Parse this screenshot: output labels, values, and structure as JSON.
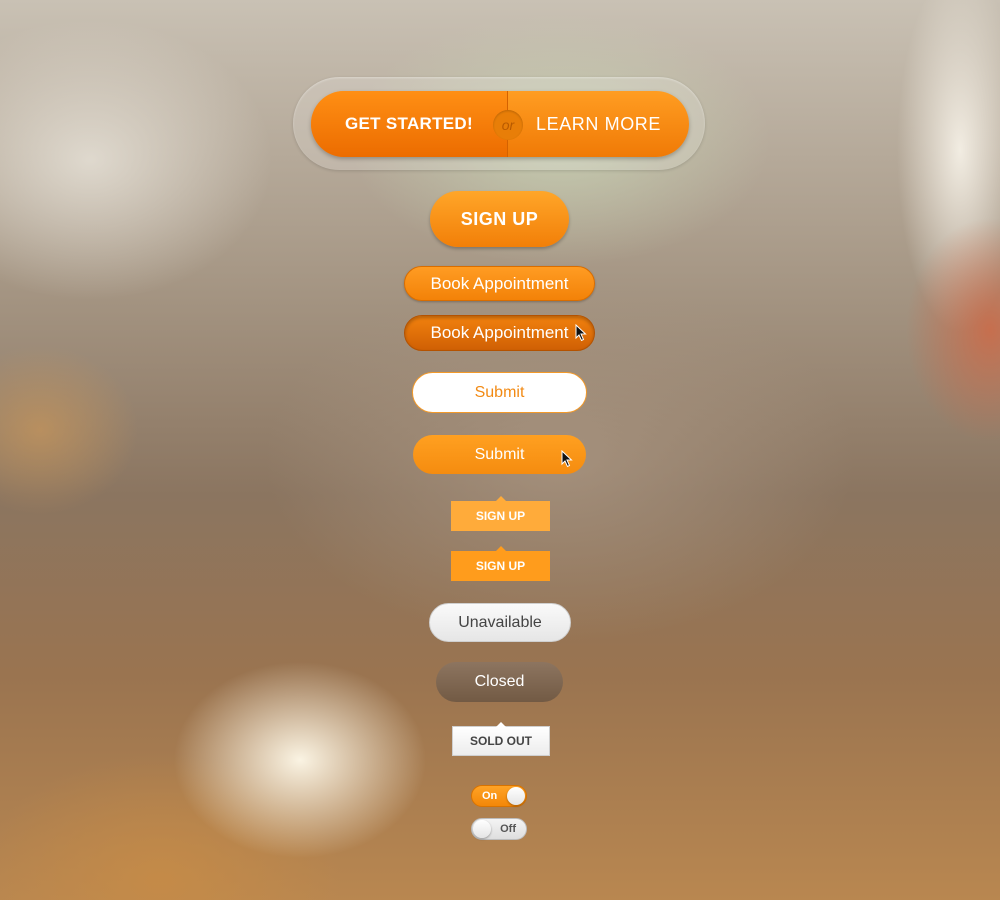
{
  "split_button": {
    "left_label": "GET STARTED!",
    "separator": "or",
    "right_label": "LEARN MORE"
  },
  "buttons": {
    "sign_up_large": "SIGN UP",
    "book_appointment": "Book Appointment",
    "book_appointment_pressed": "Book Appointment",
    "submit_outline": "Submit",
    "submit_filled": "Submit",
    "sign_up_tag": "SIGN UP",
    "sign_up_tag_active": "SIGN UP",
    "unavailable": "Unavailable",
    "closed": "Closed",
    "sold_out": "SOLD OUT"
  },
  "toggles": {
    "on_label": "On",
    "off_label": "Off"
  },
  "icons": [
    "cursor-icon"
  ],
  "colors": {
    "accent": "#f58c0f",
    "accent_dark": "#d06004",
    "closed": "#7f6752",
    "neutral": "#e6e6e6"
  }
}
